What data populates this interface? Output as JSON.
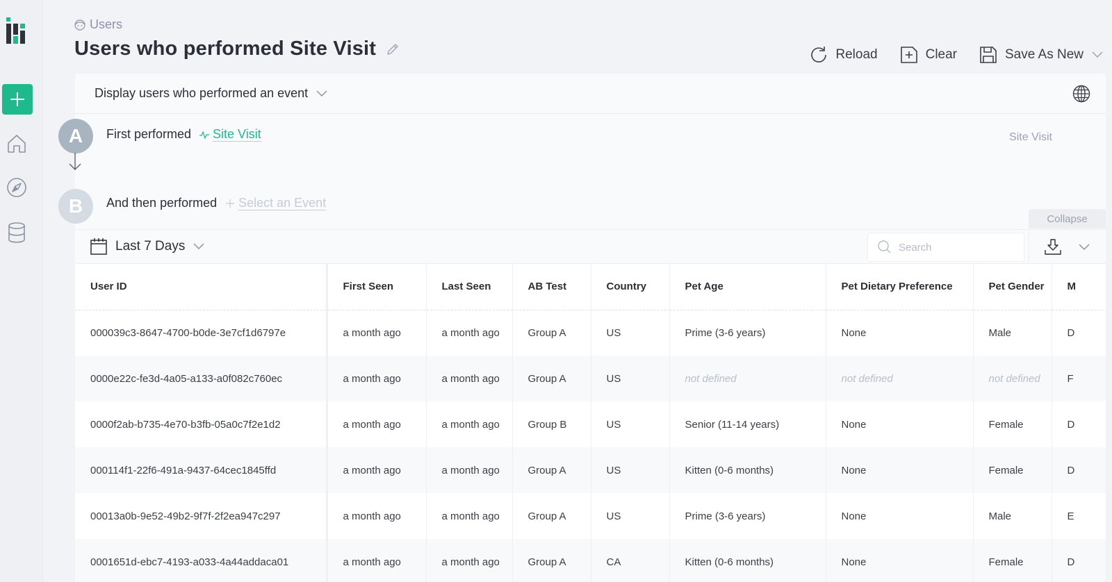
{
  "sidebar": {
    "logo": "app-logo",
    "new_button_icon": "plus-icon",
    "items": [
      {
        "name": "home",
        "icon": "home-icon"
      },
      {
        "name": "explore",
        "icon": "compass-icon"
      },
      {
        "name": "data",
        "icon": "database-icon"
      }
    ]
  },
  "header": {
    "breadcrumb": "Users",
    "breadcrumb_icon": "user-face-icon",
    "title": "Users who performed Site Visit",
    "edit_icon": "pencil-icon"
  },
  "toolbar": {
    "reload_label": "Reload",
    "clear_label": "Clear",
    "save_label": "Save As New"
  },
  "query": {
    "mode_label": "Display users who performed an event",
    "steps": [
      {
        "letter": "A",
        "prefix": "First performed",
        "event": "Site Visit",
        "summary": "Site Visit"
      },
      {
        "letter": "B",
        "prefix": "And then performed",
        "event_placeholder": "Select an Event"
      }
    ],
    "collapse_label": "Collapse"
  },
  "results": {
    "date_range": "Last 7 Days",
    "search_placeholder": "Search",
    "columns": [
      "User ID",
      "First Seen",
      "Last Seen",
      "AB Test",
      "Country",
      "Pet Age",
      "Pet Dietary Preference",
      "Pet Gender",
      "M"
    ],
    "rows": [
      [
        "000039c3-8647-4700-b0de-3e7cf1d6797e",
        "a month ago",
        "a month ago",
        "Group A",
        "US",
        "Prime (3-6 years)",
        "None",
        "Male",
        "D"
      ],
      [
        "0000e22c-fe3d-4a05-a133-a0f082c760ec",
        "a month ago",
        "a month ago",
        "Group A",
        "US",
        "not defined",
        "not defined",
        "not defined",
        "F"
      ],
      [
        "0000f2ab-b735-4e70-b3fb-05a0c7f2e1d2",
        "a month ago",
        "a month ago",
        "Group B",
        "US",
        "Senior (11-14 years)",
        "None",
        "Female",
        "D"
      ],
      [
        "000114f1-22f6-491a-9437-64cec1845ffd",
        "a month ago",
        "a month ago",
        "Group A",
        "US",
        "Kitten (0-6 months)",
        "None",
        "Female",
        "D"
      ],
      [
        "00013a0b-9e52-49b2-9f7f-2f2ea947c297",
        "a month ago",
        "a month ago",
        "Group A",
        "US",
        "Prime (3-6 years)",
        "None",
        "Male",
        "E"
      ],
      [
        "0001651d-ebc7-4193-a033-4a44addaca01",
        "a month ago",
        "a month ago",
        "Group A",
        "CA",
        "Kitten (0-6 months)",
        "None",
        "Female",
        "D"
      ]
    ],
    "undefined_value": "not defined"
  },
  "colors": {
    "accent": "#1fb98d",
    "step_a": "#a9b4c1",
    "step_b": "#d5dbe2",
    "muted_text": "#9aa3b1"
  }
}
